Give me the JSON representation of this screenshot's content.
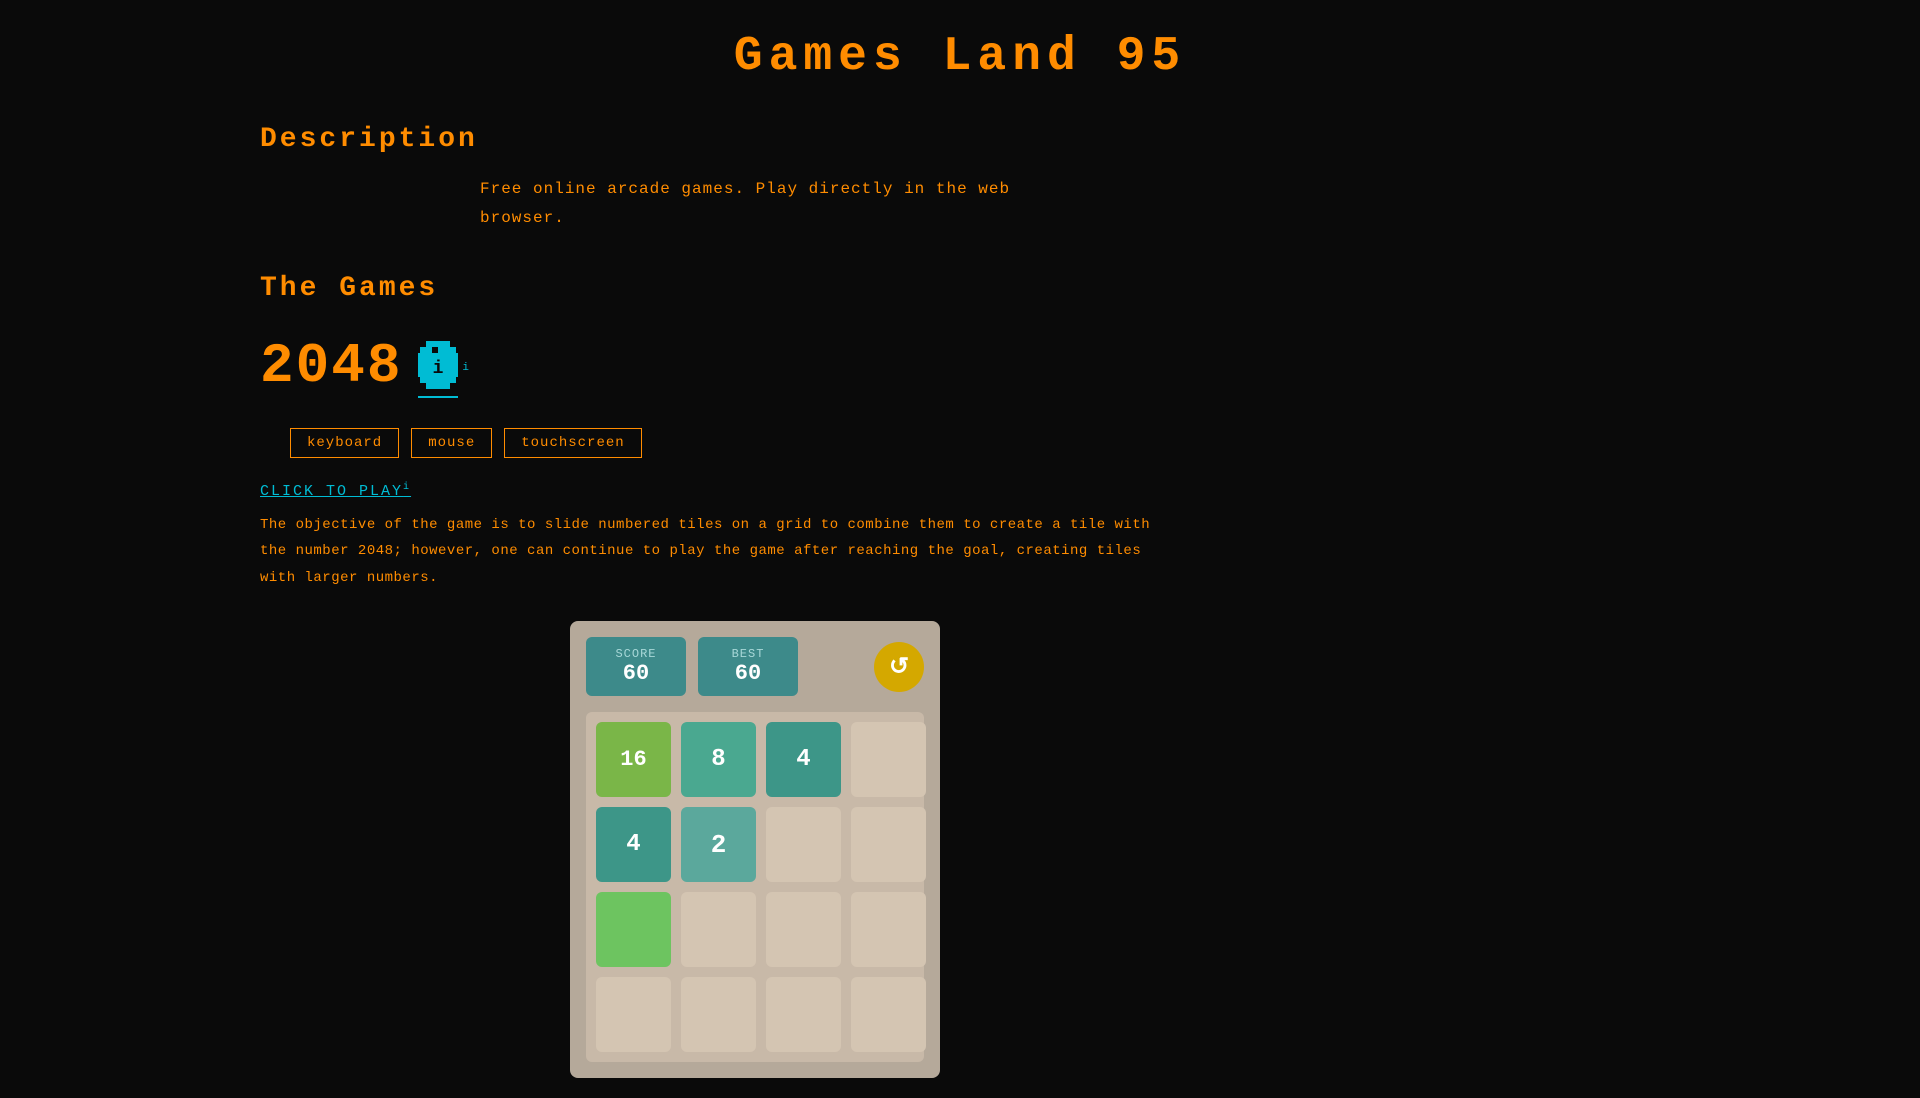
{
  "site": {
    "title": "Games  Land  95"
  },
  "description_section": {
    "heading": "Description",
    "text_line1": "Free  online  arcade  games.  Play  directly  in  the  web",
    "text_line2": "browser."
  },
  "games_section": {
    "heading": "The  Games",
    "game": {
      "title": "2048",
      "icon_label": "i",
      "tags": [
        "keyboard",
        "mouse",
        "touchscreen"
      ],
      "click_to_play": "CLICK  TO  PLAY",
      "click_sup": "i",
      "description_line1": "The  objective  of  the  game  is  to  slide  numbered  tiles  on  a  grid  to  combine  them  to  create  a  tile  with",
      "description_line2": "the  number  2048;  however,  one  can  continue  to  play  the  game  after  reaching  the  goal,  creating  tiles",
      "description_line3": "with  larger  numbers."
    }
  },
  "game_preview": {
    "score_label": "SCORE",
    "score_value": "60",
    "best_label": "BEST",
    "best_value": "60",
    "restart_icon": "↺",
    "grid": [
      {
        "value": "16",
        "type": "tile-16"
      },
      {
        "value": "8",
        "type": "tile-8"
      },
      {
        "value": "4",
        "type": "tile-4"
      },
      {
        "value": "",
        "type": "tile-empty"
      },
      {
        "value": "4",
        "type": "tile-4"
      },
      {
        "value": "2",
        "type": "tile-2"
      },
      {
        "value": "",
        "type": "tile-empty"
      },
      {
        "value": "",
        "type": "tile-empty"
      },
      {
        "value": "",
        "type": "tile-bottom"
      },
      {
        "value": "",
        "type": "tile-empty"
      },
      {
        "value": "",
        "type": "tile-empty"
      },
      {
        "value": "",
        "type": "tile-empty"
      },
      {
        "value": "",
        "type": "tile-empty"
      },
      {
        "value": "",
        "type": "tile-empty"
      },
      {
        "value": "",
        "type": "tile-empty"
      },
      {
        "value": "",
        "type": "tile-empty"
      }
    ]
  },
  "colors": {
    "orange": "#ff8c00",
    "cyan": "#00bcd4",
    "bg": "#0a0a0a"
  }
}
